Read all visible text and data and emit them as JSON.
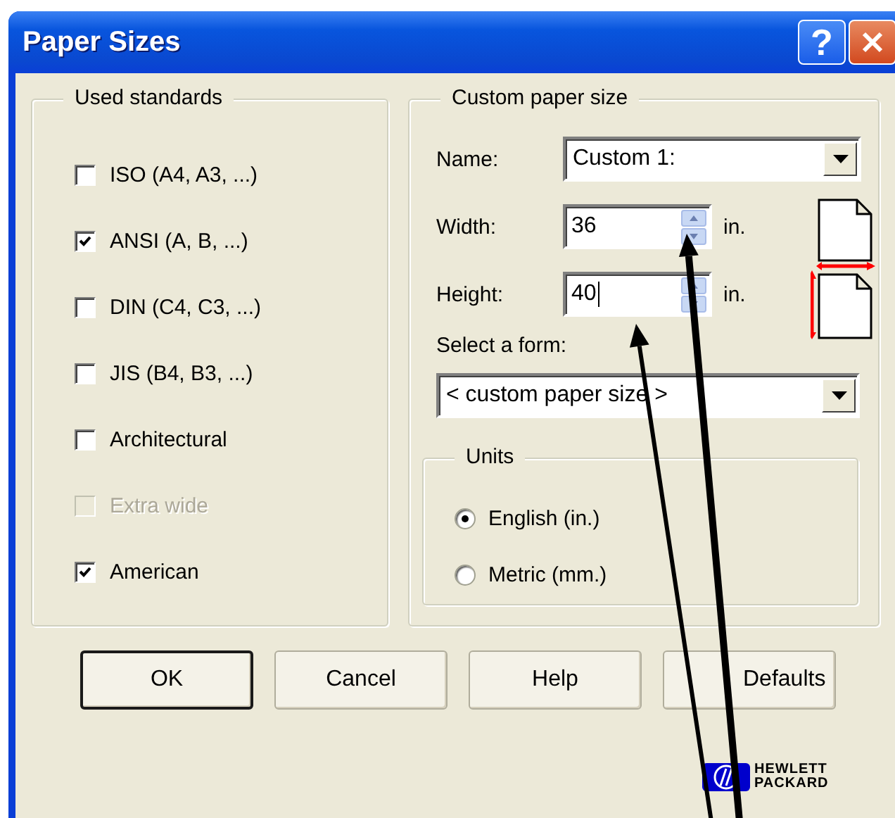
{
  "window": {
    "title": "Paper Sizes",
    "help_button": "?"
  },
  "used_standards": {
    "title": "Used standards",
    "options": [
      {
        "label": "ISO (A4, A3, ...)",
        "checked": false,
        "disabled": false
      },
      {
        "label": "ANSI (A, B, ...)",
        "checked": true,
        "disabled": false
      },
      {
        "label": "DIN (C4, C3, ...)",
        "checked": false,
        "disabled": false
      },
      {
        "label": "JIS (B4, B3, ...)",
        "checked": false,
        "disabled": false
      },
      {
        "label": "Architectural",
        "checked": false,
        "disabled": false
      },
      {
        "label": "Extra wide",
        "checked": false,
        "disabled": true
      },
      {
        "label": "American",
        "checked": true,
        "disabled": false
      }
    ]
  },
  "custom_paper_size": {
    "title": "Custom paper size",
    "name": {
      "label": "Name:",
      "value": "Custom 1:"
    },
    "width": {
      "label": "Width:",
      "value": "36",
      "unit": "in.",
      "focused": false
    },
    "height": {
      "label": "Height:",
      "value": "40",
      "unit": "in.",
      "focused": true
    },
    "form": {
      "label": "Select a form:",
      "value": "< custom paper size >"
    },
    "units": {
      "title": "Units",
      "options": [
        {
          "label": "English (in.)",
          "selected": true
        },
        {
          "label": "Metric (mm.)",
          "selected": false
        }
      ]
    }
  },
  "buttons": [
    {
      "label": "OK",
      "default": true
    },
    {
      "label": "Cancel",
      "default": false
    },
    {
      "label": "Help",
      "default": false
    },
    {
      "label": "Defaults",
      "default": false
    }
  ],
  "logo": {
    "lines": [
      "HEWLETT",
      "PACKARD"
    ]
  }
}
